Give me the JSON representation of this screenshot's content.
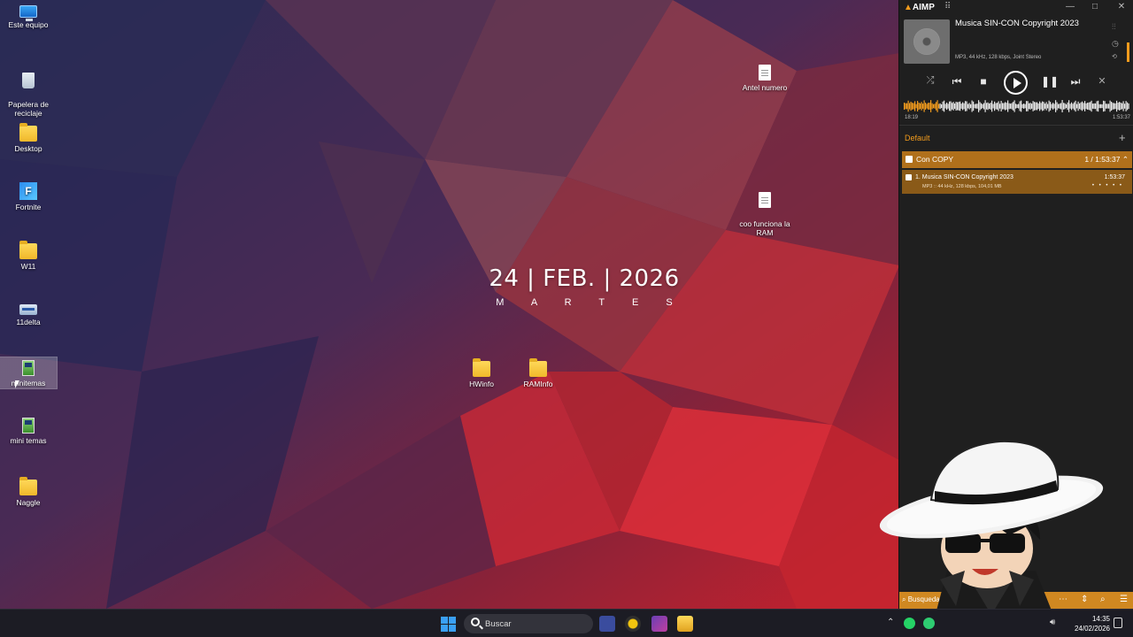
{
  "desktop": {
    "icons": [
      {
        "label": "Este equipo",
        "icon": "pc-icon"
      },
      {
        "label": "Papelera de\nreciclaje",
        "icon": "recycle-bin-icon"
      },
      {
        "label": "Desktop",
        "icon": "folder-icon"
      },
      {
        "label": "Fortnite",
        "icon": "fortnite-icon"
      },
      {
        "label": "W11",
        "icon": "folder-icon"
      },
      {
        "label": "11delta",
        "icon": "drive-icon"
      },
      {
        "label": "minitemas",
        "icon": "app-icon"
      },
      {
        "label": "mini temas",
        "icon": "app-icon"
      },
      {
        "label": "Naggle",
        "icon": "folder-icon"
      },
      {
        "label": "Antel numero",
        "icon": "document-icon"
      },
      {
        "label": "coo funciona la\nRAM",
        "icon": "document-icon"
      },
      {
        "label": "HWinfo",
        "icon": "folder-icon"
      },
      {
        "label": "RAMInfo",
        "icon": "folder-icon"
      }
    ],
    "date_widget": {
      "date": "24 | FEB. | 2026",
      "weekday": "M A R T E S"
    }
  },
  "aimp": {
    "logo": "AIMP",
    "track_title": "Musica SIN-CON Copyright 2023",
    "track_info": "MP3, 44 kHz, 128 kbps, Joint Stereo",
    "time_elapsed": "18:19",
    "time_total": "1:53:37",
    "progress": 0.16,
    "playlist_tab": "Default",
    "group": {
      "name": "Con COPY",
      "count": "1 / 1:53:37"
    },
    "track_row": {
      "title": "1. Musica SIN-CON Copyright 2023",
      "duration": "1:53:37",
      "info": "MP3 :: 44 kHz, 128 kbps, 104,01 MB",
      "rating": "• • • • •"
    },
    "search_placeholder": "Busqueda",
    "accent": "#f39c1d"
  },
  "taskbar": {
    "search_placeholder": "Buscar",
    "time": "14:35",
    "date": "24/02/2026"
  }
}
